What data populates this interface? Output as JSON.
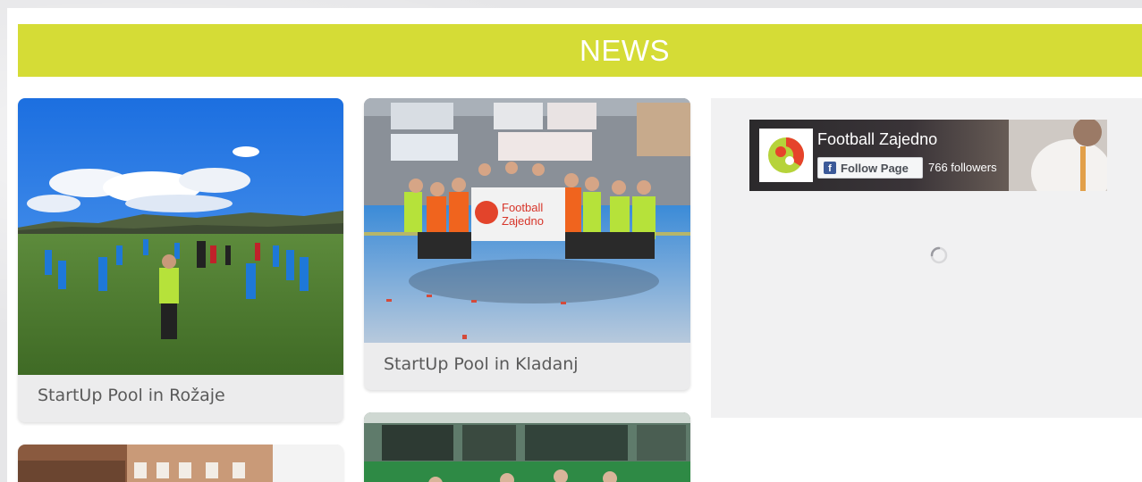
{
  "section": {
    "title": "NEWS"
  },
  "news": [
    {
      "caption": "StartUp Pool in Rožaje"
    },
    {
      "caption": "StartUp Pool in Kladanj"
    }
  ],
  "facebook": {
    "page_name": "Football Zajedno",
    "follow_label": "Follow Page",
    "followers": "766 followers",
    "fb_icon": "f"
  },
  "photo_texts": {
    "banner_line1": "Football",
    "banner_line2": "Zajedno"
  },
  "colors": {
    "banner": "#d5dc36",
    "facebook_blue": "#3b5998",
    "caption_text": "#5a5a5a"
  }
}
